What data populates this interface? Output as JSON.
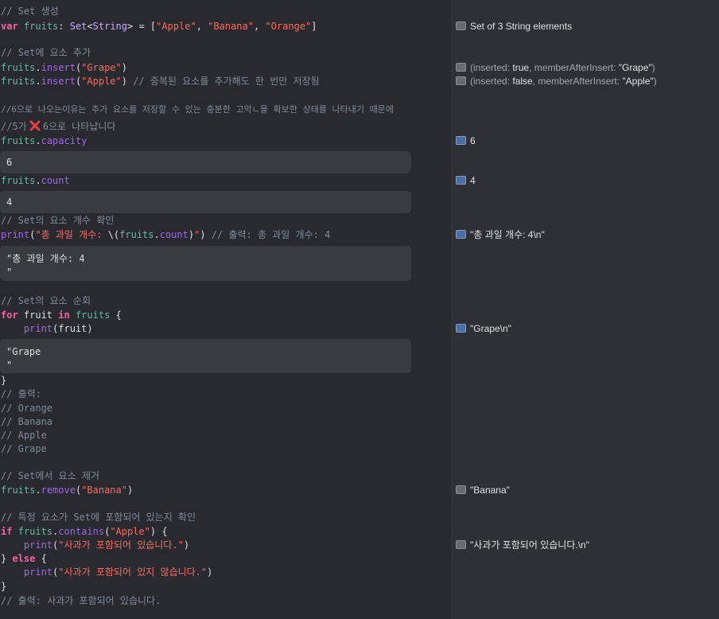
{
  "code": {
    "l1": "// Set 생성",
    "l2": {
      "kw": "var",
      "name": "fruits",
      "colon": ": ",
      "type": "Set",
      "lt": "<",
      "generic": "String",
      "gt": "> = [",
      "s1": "\"Apple\"",
      "c1": ", ",
      "s2": "\"Banana\"",
      "c2": ", ",
      "s3": "\"Orange\"",
      "end": "]"
    },
    "l3": "// Set에 요소 추가",
    "l4": {
      "obj": "fruits",
      "dot": ".",
      "m": "insert",
      "open": "(",
      "s": "\"Grape\"",
      "close": ")"
    },
    "l5": {
      "obj": "fruits",
      "dot": ".",
      "m": "insert",
      "open": "(",
      "s": "\"Apple\"",
      "close": ")",
      "cm": " // 중복된 요소를 추가해도 한 번만 저장됨"
    },
    "l6": "//6으로 나오는이유는 추가 요소를 저장할 수 있는 충분한 고악ㄴ을 확보한 상태를 나타내기 때문에",
    "l7a": "//5가",
    "l7b": "6으로 나타납니다",
    "l8": {
      "obj": "fruits",
      "dot": ".",
      "p": "capacity"
    },
    "box1": "6",
    "l9": {
      "obj": "fruits",
      "dot": ".",
      "p": "count"
    },
    "box2": "4",
    "l10": "// Set의 요소 개수 확인",
    "l11": {
      "fn": "print",
      "open": "(",
      "s1": "\"총 과일 개수: ",
      "interp_open": "\\(",
      "obj": "fruits",
      "dot": ".",
      "p": "count",
      "interp_close": ")",
      "s2": "\"",
      "close": ")",
      "cm": " // 출력: 총 과일 개수: 4"
    },
    "box3": "\"총 과일 개수: 4\n\"",
    "l12": "// Set의 요소 순회",
    "l13": {
      "kw1": "for",
      "v": " fruit ",
      "kw2": "in",
      "sp": " ",
      "obj": "fruits",
      "end": " {"
    },
    "l14": {
      "indent": "    ",
      "fn": "print",
      "open": "(",
      "v": "fruit",
      "close": ")"
    },
    "box4": "\"Grape\n\"",
    "l15": "}",
    "l16": "// 출력:",
    "l17": "// Orange",
    "l18": "// Banana",
    "l19": "// Apple",
    "l20": "// Grape",
    "l21": "// Set에서 요소 제거",
    "l22": {
      "obj": "fruits",
      "dot": ".",
      "m": "remove",
      "open": "(",
      "s": "\"Banana\"",
      "close": ")"
    },
    "l23": "// 특정 요소가 Set에 포함되어 있는지 확인",
    "l24": {
      "kw": "if",
      "sp": " ",
      "obj": "fruits",
      "dot": ".",
      "m": "contains",
      "open": "(",
      "s": "\"Apple\"",
      "close": ") {"
    },
    "l25": {
      "indent": "    ",
      "fn": "print",
      "open": "(",
      "s": "\"사과가 포함되어 있습니다.\"",
      "close": ")"
    },
    "l26": {
      "a": "} ",
      "kw": "else",
      "b": " {"
    },
    "l27": {
      "indent": "    ",
      "fn": "print",
      "open": "(",
      "s": "\"사과가 포함되어 있지 않습니다.\"",
      "close": ")"
    },
    "l28": "}",
    "l29": "// 출력: 사과가 포함되어 있습니다."
  },
  "results": {
    "r1": "Set of 3 String elements",
    "r2": {
      "p1": "(inserted: ",
      "v1": "true",
      "p2": ", memberAfterInsert: ",
      "v2": "\"Grape\"",
      "p3": ")"
    },
    "r3": {
      "p1": "(inserted: ",
      "v1": "false",
      "p2": ", memberAfterInsert: ",
      "v2": "\"Apple\"",
      "p3": ")"
    },
    "r4": "6",
    "r5": "4",
    "r6": "\"총 과일 개수: 4\\n\"",
    "r7": "\"Grape\\n\"",
    "r8": "\"Banana\"",
    "r9": "\"사과가 포함되어 있습니다.\\n\""
  },
  "icons": {
    "cross": "cross-mark-icon",
    "toggle": "result-toggle-icon"
  },
  "colors": {
    "keyword": "#fc5fa3",
    "string": "#fc6a5d",
    "comment": "#7f8c98",
    "type": "#d0a8ff",
    "property": "#a167e6",
    "variable": "#67b7a4",
    "cross": "#e8413a"
  }
}
